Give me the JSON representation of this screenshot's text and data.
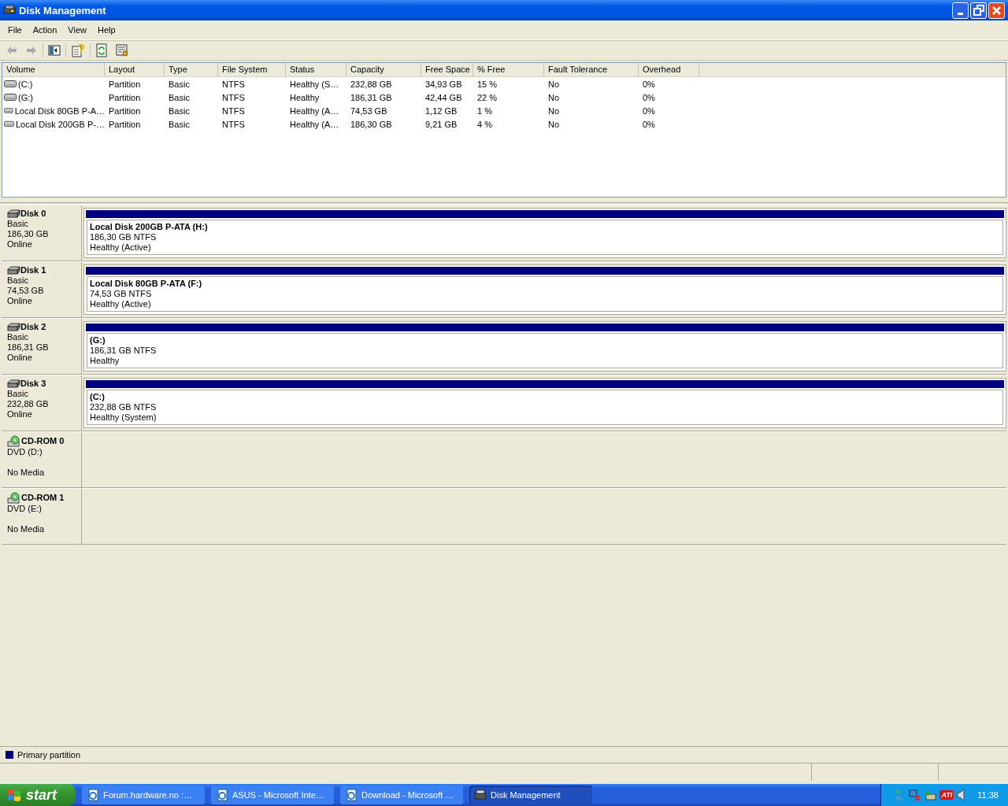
{
  "window": {
    "title": "Disk Management"
  },
  "menu": [
    "File",
    "Action",
    "View",
    "Help"
  ],
  "volume_list": {
    "columns": [
      "Volume",
      "Layout",
      "Type",
      "File System",
      "Status",
      "Capacity",
      "Free Space",
      "% Free",
      "Fault Tolerance",
      "Overhead"
    ],
    "rows": [
      [
        "(C:)",
        "Partition",
        "Basic",
        "NTFS",
        "Healthy (S…",
        "232,88 GB",
        "34,93 GB",
        "15 %",
        "No",
        "0%"
      ],
      [
        "(G:)",
        "Partition",
        "Basic",
        "NTFS",
        "Healthy",
        "186,31 GB",
        "42,44 GB",
        "22 %",
        "No",
        "0%"
      ],
      [
        "Local Disk 80GB P-A…",
        "Partition",
        "Basic",
        "NTFS",
        "Healthy (A…",
        "74,53 GB",
        "1,12 GB",
        "1 %",
        "No",
        "0%"
      ],
      [
        "Local Disk 200GB P-…",
        "Partition",
        "Basic",
        "NTFS",
        "Healthy (A…",
        "186,30 GB",
        "9,21 GB",
        "4 %",
        "No",
        "0%"
      ]
    ]
  },
  "disks": [
    {
      "kind": "disk",
      "name": "Disk 0",
      "lines": [
        "Basic",
        "186,30 GB",
        "Online"
      ],
      "partition": {
        "name": "Local Disk 200GB P-ATA  (H:)",
        "size": "186,30 GB NTFS",
        "status": "Healthy (Active)"
      }
    },
    {
      "kind": "disk",
      "name": "Disk 1",
      "lines": [
        "Basic",
        "74,53 GB",
        "Online"
      ],
      "partition": {
        "name": "Local Disk 80GB P-ATA  (F:)",
        "size": "74,53 GB NTFS",
        "status": "Healthy (Active)"
      }
    },
    {
      "kind": "disk",
      "name": "Disk 2",
      "lines": [
        "Basic",
        "186,31 GB",
        "Online"
      ],
      "partition": {
        "name": "(G:)",
        "size": "186,31 GB NTFS",
        "status": "Healthy"
      }
    },
    {
      "kind": "disk",
      "name": "Disk 3",
      "lines": [
        "Basic",
        "232,88 GB",
        "Online"
      ],
      "partition": {
        "name": "(C:)",
        "size": "232,88 GB NTFS",
        "status": "Healthy (System)"
      }
    },
    {
      "kind": "cdrom",
      "name": "CD-ROM 0",
      "lines": [
        "DVD (D:)",
        "No Media"
      ]
    },
    {
      "kind": "cdrom",
      "name": "CD-ROM 1",
      "lines": [
        "DVD (E:)",
        "No Media"
      ]
    }
  ],
  "legend": [
    "Primary partition"
  ],
  "taskbar": {
    "start": "start",
    "buttons": [
      {
        "label": "Forum.hardware.no :…",
        "selected": false
      },
      {
        "label": "ASUS - Microsoft Inte…",
        "selected": false
      },
      {
        "label": "Download - Microsoft …",
        "selected": false
      },
      {
        "label": "Disk Management",
        "selected": true
      }
    ],
    "clock": "11:38",
    "tray_text": "ATI"
  }
}
